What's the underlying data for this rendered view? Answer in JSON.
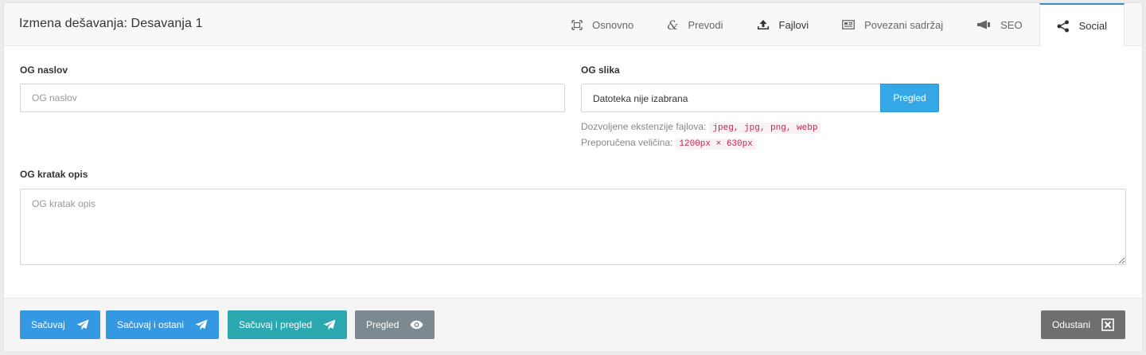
{
  "header": {
    "title": "Izmena dešavanja: Desavanja 1",
    "tabs": [
      {
        "label": "Osnovno",
        "icon": "expand-frame-icon"
      },
      {
        "label": "Prevodi",
        "icon": "ampersand-icon"
      },
      {
        "label": "Fajlovi",
        "icon": "upload-icon"
      },
      {
        "label": "Povezani sadržaj",
        "icon": "newspaper-icon"
      },
      {
        "label": "SEO",
        "icon": "megaphone-icon"
      },
      {
        "label": "Social",
        "icon": "share-icon"
      }
    ],
    "active_tab": "Social"
  },
  "form": {
    "og_title": {
      "label": "OG naslov",
      "placeholder": "OG naslov",
      "value": ""
    },
    "og_image": {
      "label": "OG slika",
      "file_text": "Datoteka nije izabrana",
      "browse_label": "Pregled",
      "extensions_label": "Dozvoljene ekstenzije fajlova:",
      "extensions": "jpeg, jpg, png, webp",
      "size_label": "Preporučena veličina:",
      "size": "1200px × 630px"
    },
    "og_description": {
      "label": "OG kratak opis",
      "placeholder": "OG kratak opis",
      "value": ""
    }
  },
  "footer": {
    "save": "Sačuvaj",
    "save_stay": "Sačuvaj i ostani",
    "save_preview": "Sačuvaj i pregled",
    "preview": "Pregled",
    "cancel": "Odustani"
  },
  "colors": {
    "primary": "#3498e3",
    "info": "#34a7e7",
    "teal": "#2ba8b0",
    "gray": "#7d8990",
    "dark_gray": "#6f6f6f",
    "tab_accent": "#3c8dbc",
    "code_red": "#c7254e"
  }
}
